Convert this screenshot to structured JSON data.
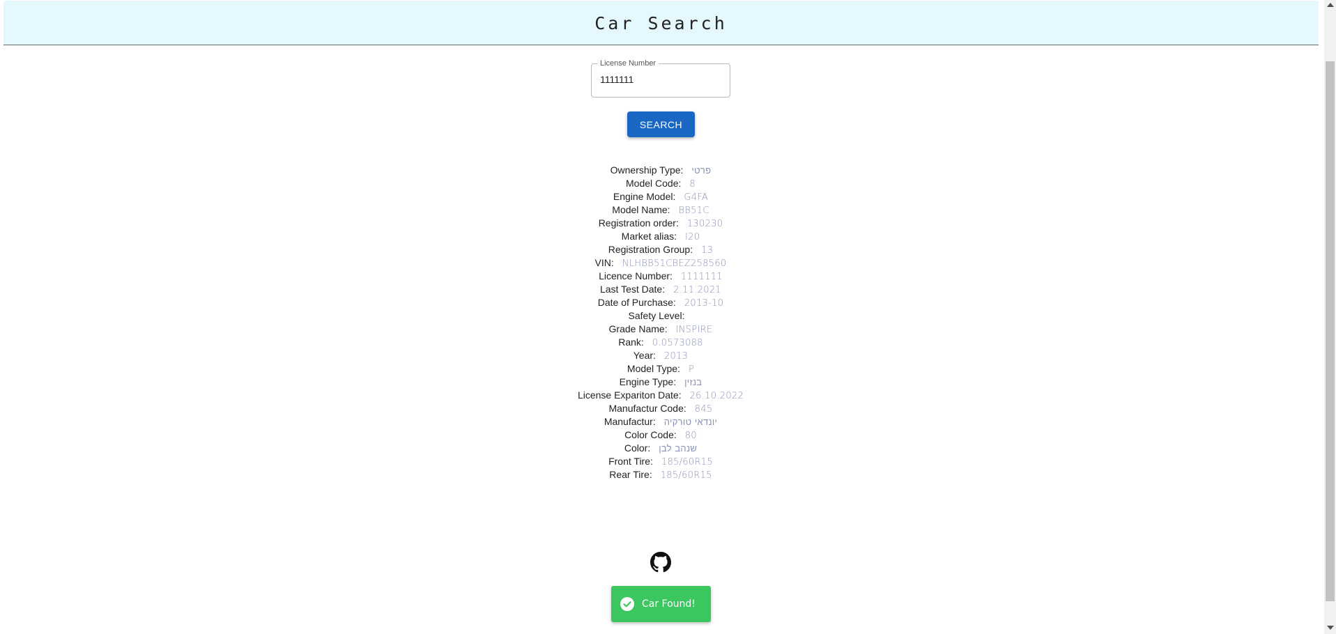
{
  "header": {
    "title": "Car Search"
  },
  "search": {
    "label": "License Number",
    "value": "1111111",
    "button_label": "Search"
  },
  "details": [
    {
      "label": "Ownership Type:",
      "value": "פרטי"
    },
    {
      "label": "Model Code:",
      "value": "8"
    },
    {
      "label": "Engine Model:",
      "value": "G4FA"
    },
    {
      "label": "Model Name:",
      "value": "BB51C"
    },
    {
      "label": "Registration order:",
      "value": "130230"
    },
    {
      "label": "Market alias:",
      "value": "I20"
    },
    {
      "label": "Registration Group:",
      "value": "13"
    },
    {
      "label": "VIN:",
      "value": "NLHBB51CBEZ258560"
    },
    {
      "label": "Licence Number:",
      "value": "1111111"
    },
    {
      "label": "Last Test Date:",
      "value": "2.11.2021"
    },
    {
      "label": "Date of Purchase:",
      "value": "2013-10"
    },
    {
      "label": "Safety Level:",
      "value": ""
    },
    {
      "label": "Grade Name:",
      "value": "INSPIRE"
    },
    {
      "label": "Rank:",
      "value": "0.0573088"
    },
    {
      "label": "Year:",
      "value": "2013"
    },
    {
      "label": "Model Type:",
      "value": "P"
    },
    {
      "label": "Engine Type:",
      "value": "בנזין"
    },
    {
      "label": "License Expariton Date:",
      "value": "26.10.2022"
    },
    {
      "label": "Manufactur Code:",
      "value": "845"
    },
    {
      "label": "Manufactur:",
      "value": "יונדאי טורקיה"
    },
    {
      "label": "Color Code:",
      "value": "80"
    },
    {
      "label": "Color:",
      "value": "שנהב לבן"
    },
    {
      "label": "Front Tire:",
      "value": "185/60R15"
    },
    {
      "label": "Rear Tire:",
      "value": "185/60R15"
    }
  ],
  "footer": {
    "icon": "github-icon"
  },
  "toast": {
    "icon": "check-circle-icon",
    "message": "Car Found!",
    "color": "#3cc660"
  },
  "colors": {
    "header_bg": "#e4f8fd",
    "button_bg": "#1967c2",
    "value_text": "#8a90b8"
  }
}
